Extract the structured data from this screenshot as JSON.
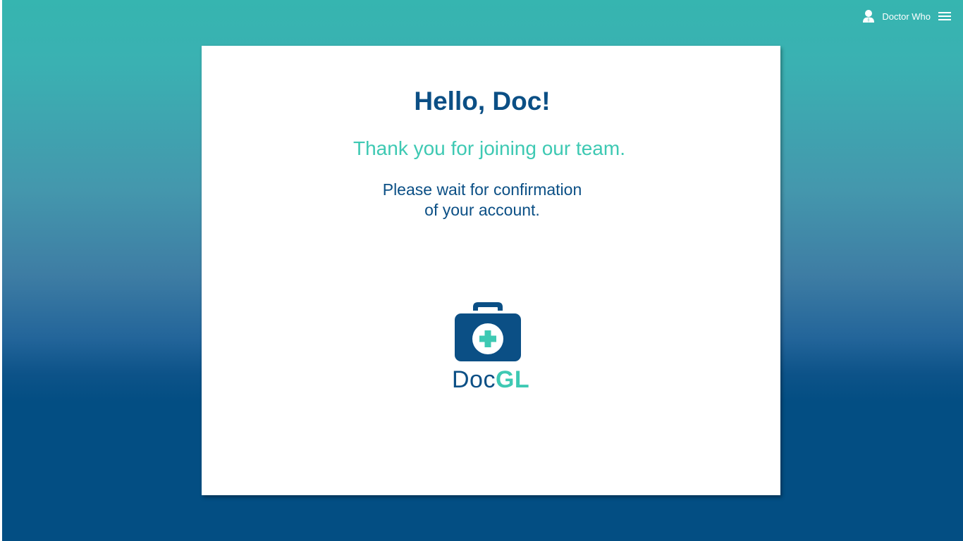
{
  "header": {
    "user_icon": "user-icon",
    "user_name": "Doctor Who",
    "menu_icon": "hamburger-menu-icon"
  },
  "card": {
    "title": "Hello, Doc!",
    "subtitle": "Thank you for joining our team.",
    "message_line1": "Please wait for confirmation",
    "message_line2": "of your account."
  },
  "logo": {
    "icon": "medical-kit-icon",
    "text_part1": "Doc",
    "text_part2": "GL"
  },
  "colors": {
    "brand_dark": "#0b4f85",
    "brand_accent": "#3ec9b3",
    "bg_top": "#36b5b0",
    "bg_bottom": "#034e83"
  }
}
